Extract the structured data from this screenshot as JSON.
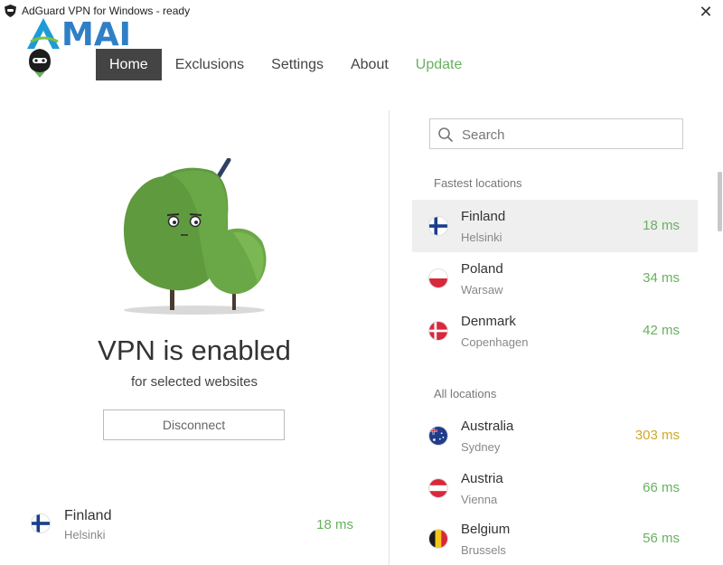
{
  "window": {
    "title": "AdGuard VPN for Windows - ready"
  },
  "watermark": {
    "text": "AMAI"
  },
  "nav": {
    "items": [
      {
        "label": "Home"
      },
      {
        "label": "Exclusions"
      },
      {
        "label": "Settings"
      },
      {
        "label": "About"
      },
      {
        "label": "Update"
      }
    ]
  },
  "status": {
    "title": "VPN is enabled",
    "subtitle": "for selected websites",
    "button_label": "Disconnect"
  },
  "current_location": {
    "city": "Finland",
    "sub": "Helsinki",
    "ping": "18 ms",
    "flag": "finland-flag"
  },
  "search": {
    "placeholder": "Search",
    "value": ""
  },
  "locations": {
    "fastest_label": "Fastest locations",
    "all_label": "All locations",
    "fastest": [
      {
        "city": "Finland",
        "sub": "Helsinki",
        "ping": "18 ms",
        "flag": "finland-flag",
        "selected": true
      },
      {
        "city": "Poland",
        "sub": "Warsaw",
        "ping": "34 ms",
        "flag": "poland-flag"
      },
      {
        "city": "Denmark",
        "sub": "Copenhagen",
        "ping": "42 ms",
        "flag": "denmark-flag"
      }
    ],
    "all": [
      {
        "city": "Australia",
        "sub": "Sydney",
        "ping": "303 ms",
        "flag": "australia-flag"
      },
      {
        "city": "Austria",
        "sub": "Vienna",
        "ping": "66 ms",
        "flag": "austria-flag"
      },
      {
        "city": "Belgium",
        "sub": "Brussels",
        "ping": "56 ms",
        "flag": "belgium-flag"
      }
    ]
  },
  "colors": {
    "ping_good": "#68b15f",
    "ping_slow": "#d2a82a",
    "nav_active_bg": "#444444",
    "update": "#68b15f"
  }
}
